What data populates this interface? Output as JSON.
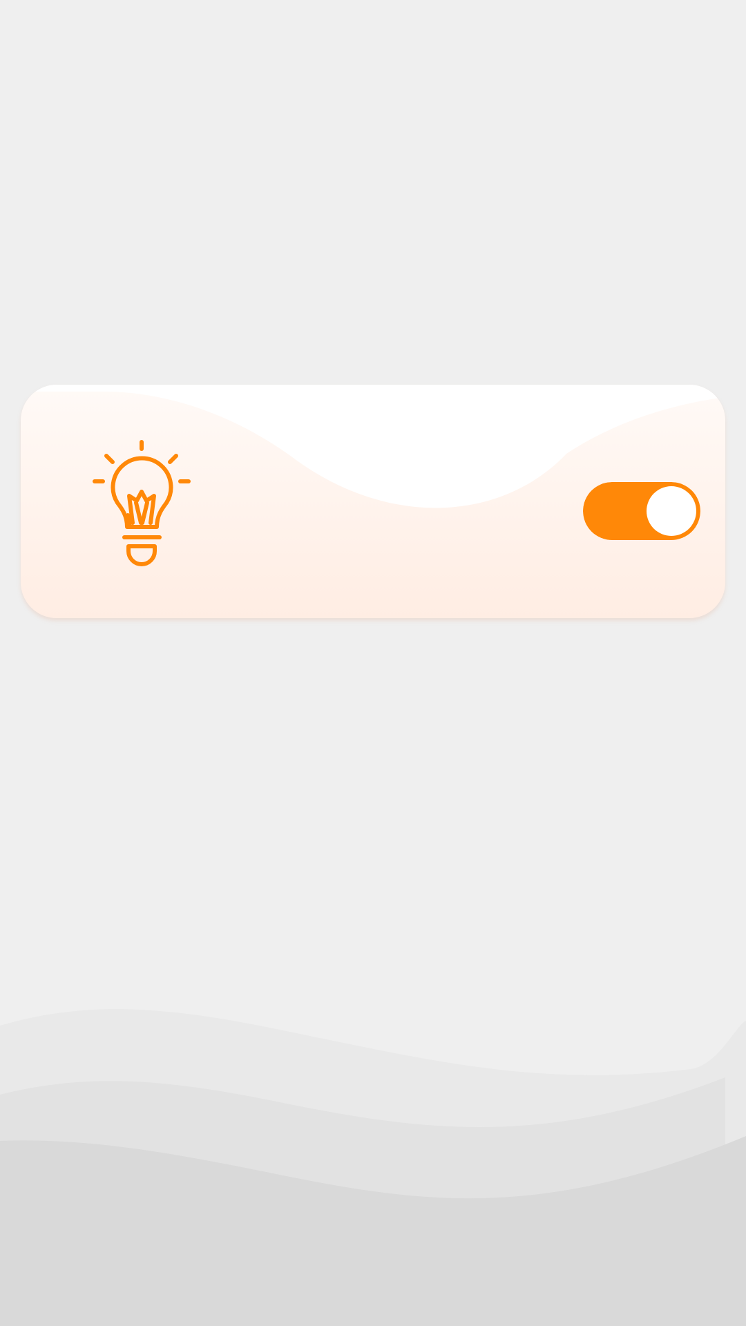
{
  "colors": {
    "background": "#efefef",
    "accent": "#ff8808",
    "card_top": "#fffaf7",
    "card_bottom": "#ffede3",
    "wave_light": "#e9e9e9",
    "wave_mid": "#e2e2e2",
    "wave_dark": "#d9d9d9"
  },
  "card": {
    "icon": "lightbulb-icon",
    "toggle": {
      "icon": "toggle-switch",
      "on": true
    }
  }
}
